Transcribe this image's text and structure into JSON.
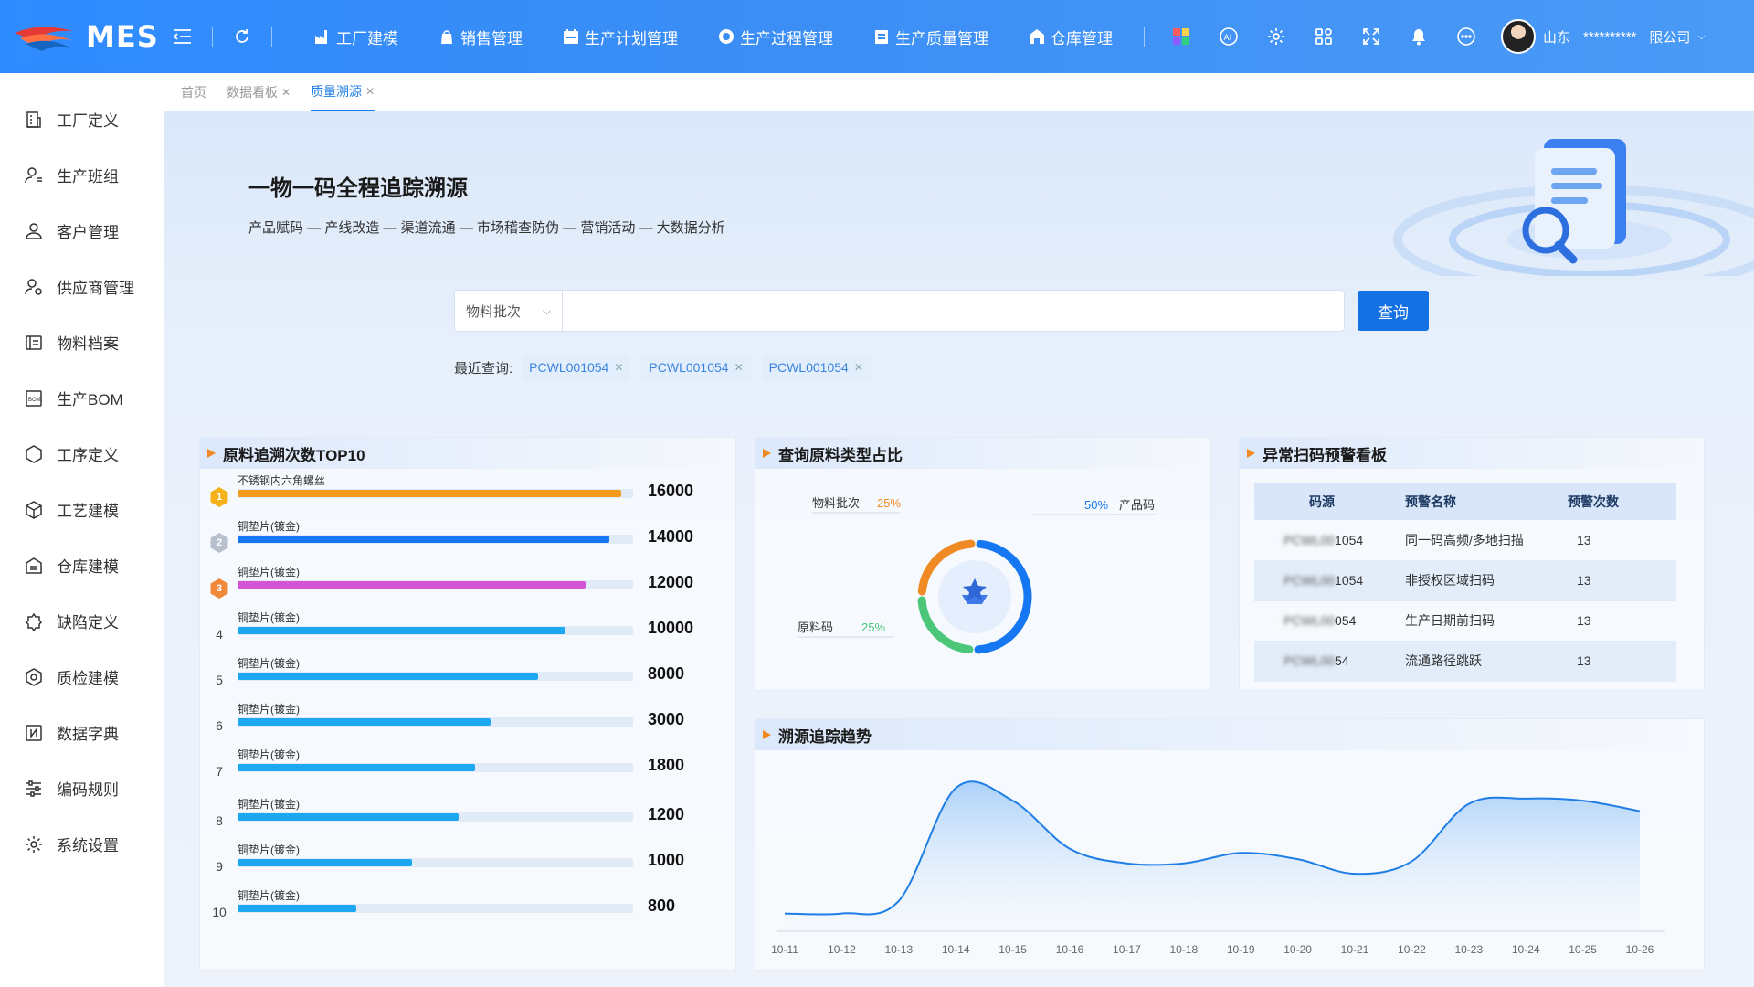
{
  "app": {
    "brand": "MES"
  },
  "header": {
    "nav": [
      {
        "label": "工厂建模",
        "icon": "factory-icon"
      },
      {
        "label": "销售管理",
        "icon": "sales-icon"
      },
      {
        "label": "生产计划管理",
        "icon": "calendar-icon"
      },
      {
        "label": "生产过程管理",
        "icon": "process-icon"
      },
      {
        "label": "生产质量管理",
        "icon": "quality-icon"
      },
      {
        "label": "仓库管理",
        "icon": "warehouse-icon"
      }
    ],
    "user": {
      "region": "山东",
      "name": "**********",
      "company": "限公司"
    }
  },
  "sidebar": {
    "items": [
      {
        "label": "工厂定义",
        "icon": "building-icon"
      },
      {
        "label": "生产班组",
        "icon": "team-icon"
      },
      {
        "label": "客户管理",
        "icon": "customer-icon"
      },
      {
        "label": "供应商管理",
        "icon": "supplier-icon"
      },
      {
        "label": "物料档案",
        "icon": "material-icon"
      },
      {
        "label": "生产BOM",
        "icon": "bom-icon"
      },
      {
        "label": "工序定义",
        "icon": "cube-icon"
      },
      {
        "label": "工艺建模",
        "icon": "box-icon"
      },
      {
        "label": "仓库建模",
        "icon": "warehouse-icon"
      },
      {
        "label": "缺陷定义",
        "icon": "defect-icon"
      },
      {
        "label": "质检建模",
        "icon": "inspect-icon"
      },
      {
        "label": "数据字典",
        "icon": "dictionary-icon"
      },
      {
        "label": "编码规则",
        "icon": "sliders-icon"
      },
      {
        "label": "系统设置",
        "icon": "gear-icon"
      }
    ]
  },
  "tabs": [
    {
      "label": "首页",
      "closable": false,
      "active": false
    },
    {
      "label": "数据看板",
      "closable": true,
      "active": false
    },
    {
      "label": "质量溯源",
      "closable": true,
      "active": true
    }
  ],
  "hero": {
    "title": "一物一码全程追踪溯源",
    "subtitle": "产品赋码 — 产线改造 — 渠道流通 — 市场稽查防伪 — 营销活动 — 大数据分析"
  },
  "search": {
    "select_value": "物料批次",
    "input_value": "",
    "button_label": "查询",
    "recent_label": "最近查询:",
    "recent": [
      "PCWL001054",
      "PCWL001054",
      "PCWL001054"
    ]
  },
  "panels": {
    "top10": {
      "title": "原料追溯次数TOP10",
      "rows": [
        {
          "rank": "1",
          "name": "不锈钢内六角螺丝",
          "value": 16000,
          "fill": 0.97,
          "color": "#f39a1c"
        },
        {
          "rank": "2",
          "name": "铜垫片(镀金)",
          "value": 14000,
          "fill": 0.94,
          "color": "#1677f2"
        },
        {
          "rank": "3",
          "name": "铜垫片(镀金)",
          "value": 12000,
          "fill": 0.88,
          "color": "#d454d6"
        },
        {
          "rank": "4",
          "name": "铜垫片(镀金)",
          "value": 10000,
          "fill": 0.83,
          "color": "#1ea8f2"
        },
        {
          "rank": "5",
          "name": "铜垫片(镀金)",
          "value": 8000,
          "fill": 0.76,
          "color": "#1ea8f2"
        },
        {
          "rank": "6",
          "name": "铜垫片(镀金)",
          "value": 3000,
          "fill": 0.64,
          "color": "#1ea8f2"
        },
        {
          "rank": "7",
          "name": "铜垫片(镀金)",
          "value": 1800,
          "fill": 0.6,
          "color": "#1ea8f2"
        },
        {
          "rank": "8",
          "name": "铜垫片(镀金)",
          "value": 1200,
          "fill": 0.56,
          "color": "#1ea8f2"
        },
        {
          "rank": "9",
          "name": "铜垫片(镀金)",
          "value": 1000,
          "fill": 0.44,
          "color": "#1ea8f2"
        },
        {
          "rank": "10",
          "name": "铜垫片(镀金)",
          "value": 800,
          "fill": 0.3,
          "color": "#1ea8f2"
        }
      ]
    },
    "ratio": {
      "title": "查询原料类型占比",
      "slices": [
        {
          "name": "物料批次",
          "pct": "25%",
          "value": 25,
          "color": "#f08a24"
        },
        {
          "name": "产品码",
          "pct": "50%",
          "value": 50,
          "color": "#1677f2"
        },
        {
          "name": "原料码",
          "pct": "25%",
          "value": 25,
          "color": "#4cc77a"
        }
      ]
    },
    "alerts": {
      "title": "异常扫码预警看板",
      "headers": [
        "码源",
        "预警名称",
        "预警次数"
      ],
      "rows": [
        {
          "code_hidden": "PCWL00",
          "code_tail": "1054",
          "name": "同一码高频/多地扫描",
          "count": "13"
        },
        {
          "code_hidden": "PCWL00",
          "code_tail": "1054",
          "name": "非授权区域扫码",
          "count": "13"
        },
        {
          "code_hidden": "PCWL00",
          "code_tail": "054",
          "name": "生产日期前扫码",
          "count": "13"
        },
        {
          "code_hidden": "PCWL00",
          "code_tail": "54",
          "name": "流通路径跳跃",
          "count": "13"
        }
      ]
    },
    "trend": {
      "title": "溯源追踪趋势"
    }
  },
  "chart_data": {
    "type": "area",
    "x": [
      "10-11",
      "10-12",
      "10-13",
      "10-14",
      "10-15",
      "10-16",
      "10-17",
      "10-18",
      "10-19",
      "10-20",
      "10-21",
      "10-22",
      "10-23",
      "10-24",
      "10-25",
      "10-26"
    ],
    "values": [
      10,
      10,
      22,
      130,
      118,
      72,
      58,
      58,
      68,
      62,
      48,
      60,
      115,
      120,
      118,
      108
    ],
    "ylim": [
      0,
      140
    ],
    "grid": false,
    "color": "#1e7ee6"
  }
}
